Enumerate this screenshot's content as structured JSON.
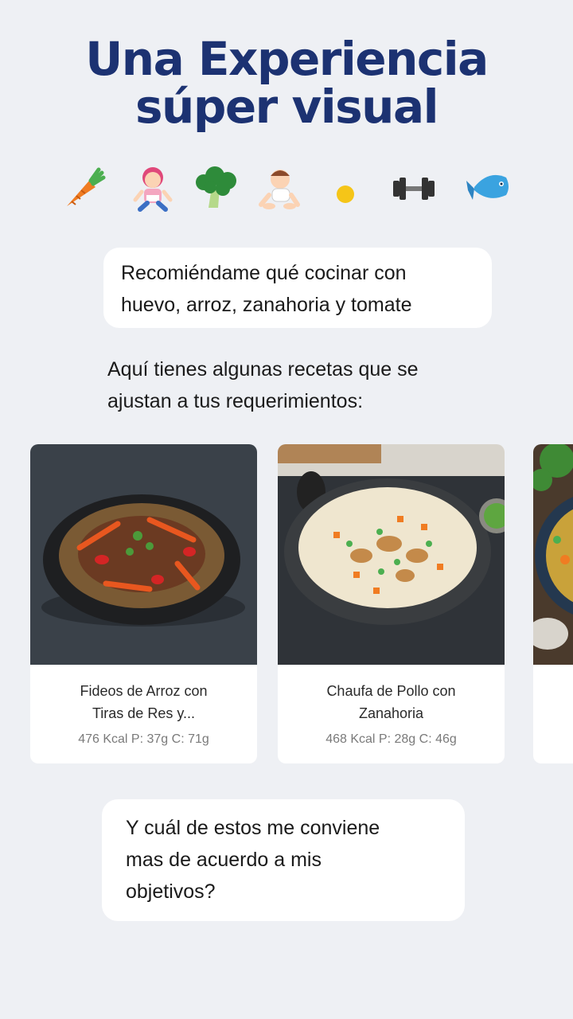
{
  "headline": {
    "line1": "Una Experiencia",
    "line2": "súper visual"
  },
  "icons": [
    "carrot-icon",
    "girl-icon",
    "broccoli-icon",
    "baby-icon",
    "sun-icon",
    "dumbbell-icon",
    "fish-icon"
  ],
  "chat": {
    "user_message_1": {
      "line1": "Recomiéndame qué cocinar con",
      "line2": "huevo, arroz, zanahoria y tomate"
    },
    "assistant_reply": {
      "line1": "Aquí tienes algunas recetas que se",
      "line2": "ajustan a tus requerimientos:"
    },
    "user_message_2": {
      "line1": "Y cuál de estos me conviene",
      "line2": "mas de acuerdo a mis",
      "line3": "objetivos?"
    }
  },
  "recipes": [
    {
      "title_line1": "Fideos de Arroz con",
      "title_line2": "Tiras de Res y...",
      "macros": "476 Kcal P: 37g C: 71g"
    },
    {
      "title_line1": "Chaufa de Pollo con",
      "title_line2": "Zanahoria",
      "macros": "468 Kcal P: 28g C: 46g"
    }
  ],
  "colors": {
    "headline": "#1c3272",
    "background": "#eef0f4",
    "card": "#ffffff"
  }
}
